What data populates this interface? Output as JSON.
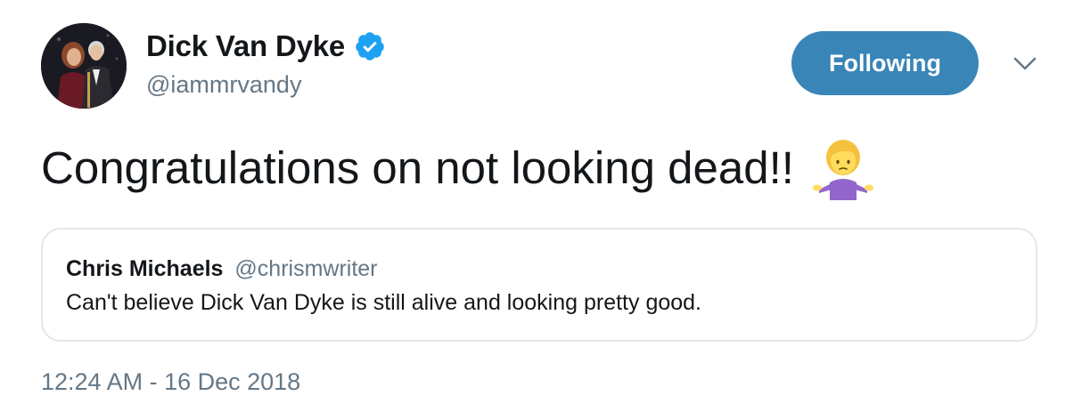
{
  "author": {
    "display_name": "Dick Van Dyke",
    "handle": "@iammrvandy",
    "verified": true,
    "avatar_icon": "profile-photo"
  },
  "actions": {
    "follow_label": "Following",
    "menu_icon": "chevron-down-icon"
  },
  "tweet": {
    "text": "Congratulations on not looking dead!!",
    "emoji": "woman-shrugging"
  },
  "quoted_tweet": {
    "display_name": "Chris Michaels",
    "handle": "@chrismwriter",
    "text": "Can't believe Dick Van Dyke is still alive and looking pretty good."
  },
  "timestamp": "12:24 AM - 16 Dec 2018",
  "colors": {
    "follow_button": "#3a85b7",
    "verified_badge": "#1da1f2",
    "secondary_text": "#657786",
    "border": "#e1e8ed"
  }
}
